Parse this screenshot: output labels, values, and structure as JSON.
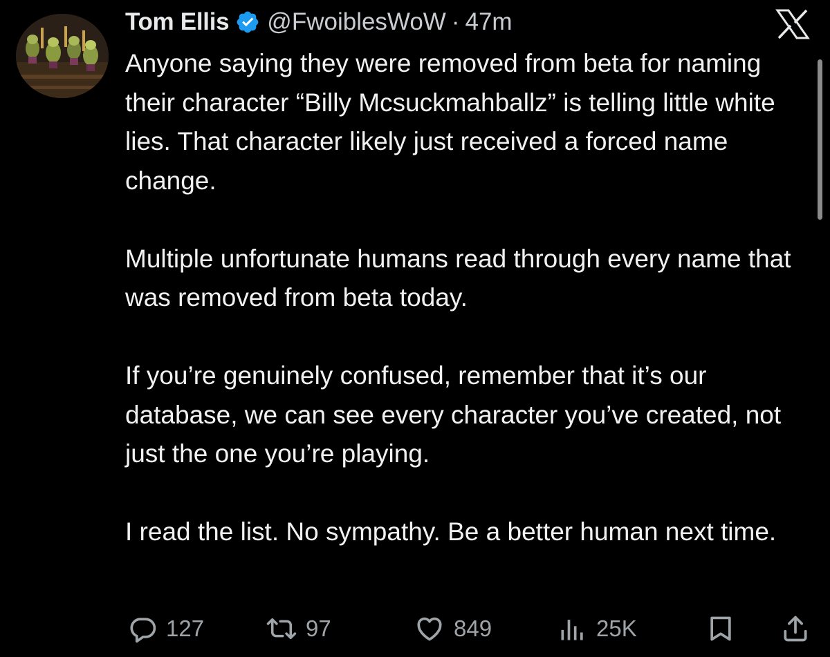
{
  "author": {
    "display_name": "Tom Ellis",
    "handle": "@FwoiblesWoW",
    "separator": "·",
    "time": "47m",
    "verified": true
  },
  "platform_logo": "X",
  "tweet": {
    "paragraphs": [
      "Anyone saying they were removed from beta for naming their character “Billy Mcsuckmahballz” is telling little white lies. That character likely just received a forced name change.",
      "Multiple unfortunate humans read through every name that was removed from beta today.",
      "If you’re genuinely confused, remember that it’s our database, we can see every character you’ve created, not just the one you’re playing.",
      "I read the list. No sympathy. Be a better human next time."
    ]
  },
  "actions": {
    "replies": "127",
    "reposts": "97",
    "likes": "849",
    "views": "25K"
  },
  "icons": {
    "verified": "verified-badge-icon",
    "reply": "reply-icon",
    "repost": "repost-icon",
    "like": "heart-icon",
    "views": "views-icon",
    "bookmark": "bookmark-icon",
    "share": "share-icon"
  },
  "colors": {
    "background": "#000000",
    "text": "#e7e9ea",
    "muted": "#9fa4a9",
    "verified": "#1d9bf0"
  }
}
